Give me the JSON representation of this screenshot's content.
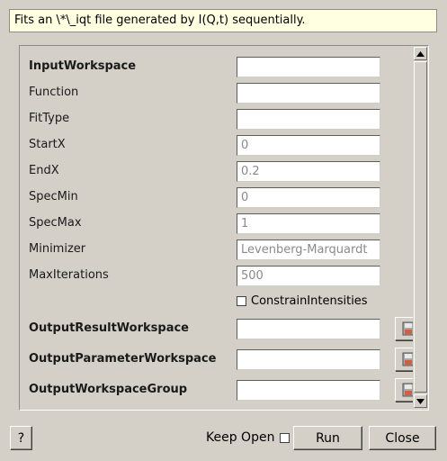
{
  "description": "Fits an \\*\\_iqt file generated by I(Q,t) sequentially.",
  "properties": [
    {
      "label": "InputWorkspace",
      "value": "",
      "bold": true
    },
    {
      "label": "Function",
      "value": "",
      "bold": false
    },
    {
      "label": "FitType",
      "value": "",
      "bold": false
    },
    {
      "label": "StartX",
      "value": "0",
      "bold": false
    },
    {
      "label": "EndX",
      "value": "0.2",
      "bold": false
    },
    {
      "label": "SpecMin",
      "value": "0",
      "bold": false
    },
    {
      "label": "SpecMax",
      "value": "1",
      "bold": false
    },
    {
      "label": "Minimizer",
      "value": "Levenberg-Marquardt",
      "bold": false
    },
    {
      "label": "MaxIterations",
      "value": "500",
      "bold": false
    }
  ],
  "constrain_label": "ConstrainIntensities",
  "constrain_checked": false,
  "outputs": [
    {
      "label": "OutputResultWorkspace",
      "value": ""
    },
    {
      "label": "OutputParameterWorkspace",
      "value": ""
    },
    {
      "label": "OutputWorkspaceGroup",
      "value": ""
    }
  ],
  "footer": {
    "help_label": "?",
    "keep_open_label": "Keep Open",
    "keep_open_checked": false,
    "run_label": "Run",
    "close_label": "Close"
  }
}
